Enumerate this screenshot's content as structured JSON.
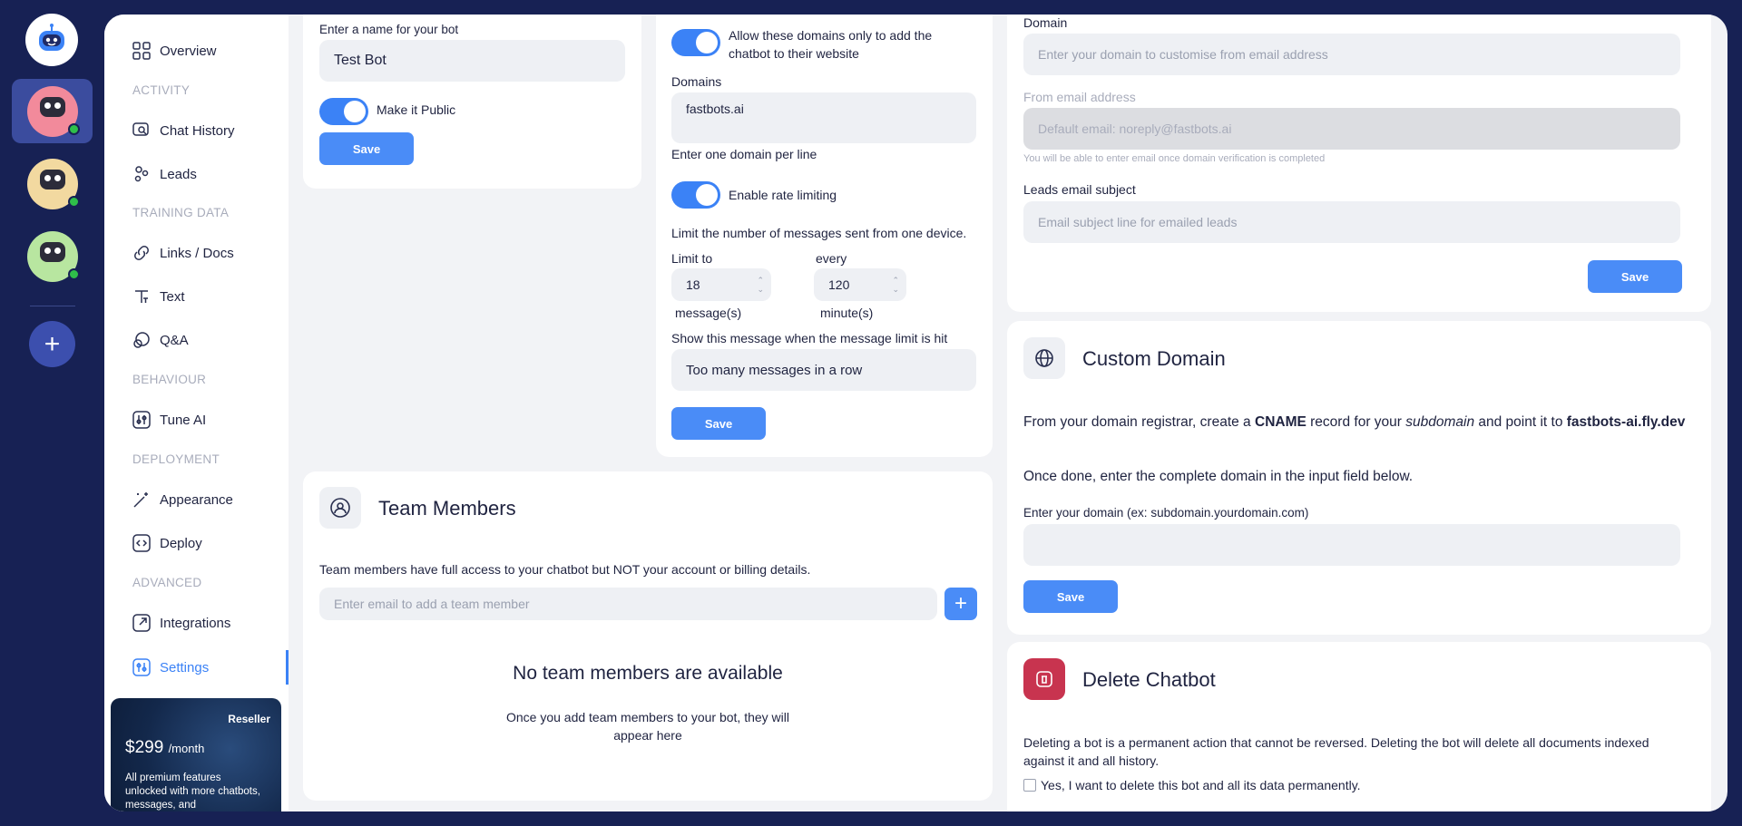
{
  "sidebar": {
    "items": [
      {
        "label": "Overview",
        "icon": "grid-icon"
      },
      {
        "label": "Chat History",
        "icon": "chat-search-icon"
      },
      {
        "label": "Leads",
        "icon": "people-icon"
      },
      {
        "label": "Links / Docs",
        "icon": "link-icon"
      },
      {
        "label": "Text",
        "icon": "text-icon"
      },
      {
        "label": "Q&A",
        "icon": "qa-icon"
      },
      {
        "label": "Tune AI",
        "icon": "sliders-icon"
      },
      {
        "label": "Appearance",
        "icon": "magic-wand-icon"
      },
      {
        "label": "Deploy",
        "icon": "code-icon"
      },
      {
        "label": "Integrations",
        "icon": "external-link-icon"
      },
      {
        "label": "Settings",
        "icon": "settings-sliders-icon"
      }
    ],
    "sections": {
      "activity": "ACTIVITY",
      "training": "TRAINING DATA",
      "behaviour": "BEHAVIOUR",
      "deployment": "DEPLOYMENT",
      "advanced": "ADVANCED"
    },
    "promo": {
      "tag": "Reseller",
      "price": "$299",
      "period": "/month",
      "desc": "All premium features unlocked with more chatbots, messages, and"
    }
  },
  "bot_name_card": {
    "name_label": "Enter a name for your bot",
    "name_value": "Test Bot",
    "public_label": "Make it Public",
    "save": "Save"
  },
  "domains_card": {
    "allow_label": "Allow these domains only to add the chatbot to their website",
    "domains_label": "Domains",
    "domains_value": "fastbots.ai",
    "domains_hint": "Enter one domain per line",
    "rate_label": "Enable rate limiting",
    "rate_desc": "Limit the number of messages sent from one device.",
    "limit_to_label": "Limit to",
    "every_label": "every",
    "limit_value": "18",
    "every_value": "120",
    "limit_unit": "message(s)",
    "every_unit": "minute(s)",
    "limit_msg_label": "Show this message when the message limit is hit",
    "limit_msg_value": "Too many messages in a row",
    "save": "Save"
  },
  "email_card": {
    "domain_label": "Domain",
    "domain_placeholder": "Enter your domain to customise from email address",
    "from_label": "From email address",
    "from_value": "Default email: noreply@fastbots.ai",
    "from_hint": "You will be able to enter email once domain verification is completed",
    "subject_label": "Leads email subject",
    "subject_placeholder": "Email subject line for emailed leads",
    "save": "Save"
  },
  "team_card": {
    "title": "Team Members",
    "desc": "Team members have full access to your chatbot but NOT your account or billing details.",
    "email_placeholder": "Enter email to add a team member",
    "empty_title": "No team members are available",
    "empty_desc": "Once you add team members to your bot, they will appear here"
  },
  "custom_domain_card": {
    "title": "Custom Domain",
    "instr_part1": "From your domain registrar, create a ",
    "instr_cname": "CNAME",
    "instr_part2": " record for your ",
    "instr_sub": "subdomain",
    "instr_part3": " and point it to ",
    "instr_target": "fastbots-ai.fly.dev",
    "done_text": "Once done, enter the complete domain in the input field below.",
    "input_label": "Enter your domain (ex: subdomain.yourdomain.com)",
    "save": "Save"
  },
  "delete_card": {
    "title": "Delete Chatbot",
    "desc": "Deleting a bot is a permanent action that cannot be reversed. Deleting the bot will delete all documents indexed against it and all history.",
    "confirm_label": "Yes, I want to delete this bot and all its data permanently."
  },
  "colors": {
    "accent": "#3b82f6",
    "button": "#4a8cf7",
    "rail_bg": "#172154",
    "danger": "#c8344f"
  }
}
